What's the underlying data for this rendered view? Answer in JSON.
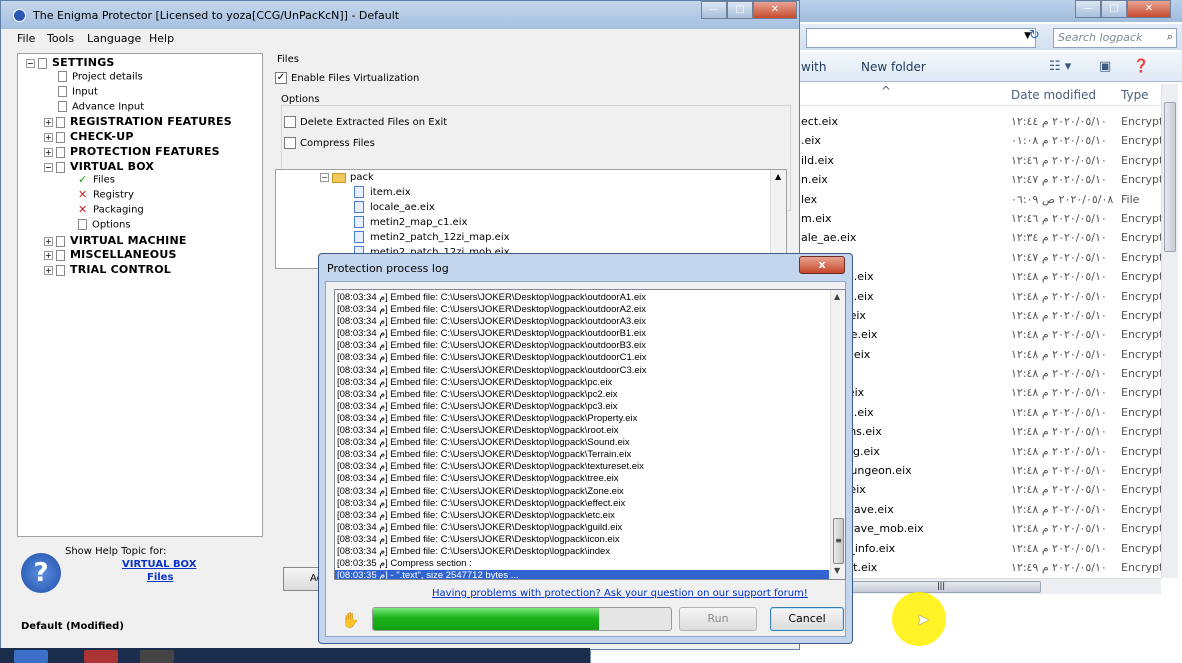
{
  "explorer": {
    "search_placeholder": "Search logpack",
    "toolbar_partial": "with",
    "new_folder": "New folder",
    "header_name_arrow": "^",
    "header_date": "Date modified",
    "header_type": "Type",
    "rows": [
      {
        "name": "ect.eix",
        "date": "٢٠٢٠/٠٥/١٠ م ١٢:٤٤",
        "type": "Encrypt"
      },
      {
        "name": ".eix",
        "date": "٢٠٢٠/٠٥/١٠ م ٠١:٠٨",
        "type": "Encrypt"
      },
      {
        "name": "ild.eix",
        "date": "٢٠٢٠/٠٥/١٠ م ١٢:٤٦",
        "type": "Encrypt"
      },
      {
        "name": "n.eix",
        "date": "٢٠٢٠/٠٥/١٠ م ١٢:٤٧",
        "type": "Encrypt"
      },
      {
        "name": "lex",
        "date": "٢٠٢٠/٠٥/٠٨ ص ٠٦:٠٩",
        "type": "File"
      },
      {
        "name": "m.eix",
        "date": "٢٠٢٠/٠٥/١٠ م ١٢:٤٦",
        "type": "Encrypt"
      },
      {
        "name": "ale_ae.eix",
        "date": "٢٠٢٠/٠٥/١٠ م ١٢:٣٤",
        "type": "Encrypt"
      },
      {
        "name": "c1.eix",
        "date": "٢٠٢٠/٠٥/١٠ م ١٢:٤٧",
        "type": "Encrypt"
      },
      {
        "name": "12zi_map.eix",
        "date": "٢٠٢٠/٠٥/١٠ م ١٢:٤٨",
        "type": "Encrypt"
      },
      {
        "name": "12zi_mob.eix",
        "date": "٢٠٢٠/٠٥/١٠ م ١٢:٤٨",
        "type": "Encrypt"
      },
      {
        "name": "12zi_obj.eix",
        "date": "٢٠٢٠/٠٥/١٠ م ١٢:٤٨",
        "type": "Encrypt"
      },
      {
        "name": "aggregate.eix",
        "date": "٢٠٢٠/٠٥/١٠ م ١٢:٤٨",
        "type": "Encrypt"
      },
      {
        "name": "arch_box.eix",
        "date": "٢٠٢٠/٠٥/١٠ م ١٢:٤٨",
        "type": "Encrypt"
      },
      {
        "name": "arena.eix",
        "date": "٢٠٢٠/٠٥/١٠ م ١٢:٤٨",
        "type": "Encrypt"
      },
      {
        "name": "balance.eix",
        "date": "٢٠٢٠/٠٥/١٠ م ١٢:٤٨",
        "type": "Encrypt"
      },
      {
        "name": "battlefied.eix",
        "date": "٢٠٢٠/٠٥/١٠ م ١٢:٤٨",
        "type": "Encrypt"
      },
      {
        "name": "beta_items.eix",
        "date": "٢٠٢٠/٠٥/١٠ م ١٢:٤٨",
        "type": "Encrypt"
      },
      {
        "name": "catch_king.eix",
        "date": "٢٠٢٠/٠٥/١٠ م ١٢:٤٨",
        "type": "Encrypt"
      },
      {
        "name": "crystal_dungeon.eix",
        "date": "٢٠٢٠/٠٥/١٠ م ١٢:٤٨",
        "type": "Encrypt"
      },
      {
        "name": "damage.eix",
        "date": "٢٠٢٠/٠٥/١٠ م ١٢:٤٨",
        "type": "Encrypt"
      },
      {
        "name": "defensewave.eix",
        "date": "٢٠٢٠/٠٥/١٠ م ١٢:٤٨",
        "type": "Encrypt"
      },
      {
        "name": "defensewave_mob.eix",
        "date": "٢٠٢٠/٠٥/١٠ م ١٢:٤٨",
        "type": "Encrypt"
      },
      {
        "name": "dungeon_info.eix",
        "date": "٢٠٢٠/٠٥/١٠ م ١٢:٤٨",
        "type": "Encrypt"
      },
      {
        "name": "fish_event.eix",
        "date": "٢٠٢٠/٠٥/١٠ م ١٢:٤٩",
        "type": "Encrypt"
      }
    ]
  },
  "enigma": {
    "title": "The Enigma Protector [Licensed to yoza[CCG/UnPacKcN]] - Default",
    "menu": [
      "File",
      "Tools",
      "Language",
      "Help"
    ],
    "tree": {
      "settings": "SETTINGS",
      "project_details": "Project details",
      "input": "Input",
      "advance_input": "Advance Input",
      "registration": "REGISTRATION FEATURES",
      "checkup": "CHECK-UP",
      "protection": "PROTECTION FEATURES",
      "virtual_box": "VIRTUAL BOX",
      "files": "Files",
      "registry": "Registry",
      "packaging": "Packaging",
      "options": "Options",
      "virtual_machine": "VIRTUAL MACHINE",
      "miscellaneous": "MISCELLANEOUS",
      "trial_control": "TRIAL CONTROL"
    },
    "help": {
      "label": "Show Help Topic for:",
      "link1": "VIRTUAL BOX",
      "link2": "Files"
    },
    "status": "Default  (Modified)",
    "files_panel": {
      "heading": "Files",
      "enable_virtualization": "Enable Files Virtualization",
      "options_heading": "Options",
      "delete_extracted": "Delete Extracted Files on Exit",
      "compress_files": "Compress Files",
      "add_button": "Add"
    },
    "file_tree": {
      "folder": "pack",
      "files": [
        "item.eix",
        "locale_ae.eix",
        "metin2_map_c1.eix",
        "metin2_patch_12zi_map.eix",
        "metin2_patch_12zi_mob.eix"
      ]
    }
  },
  "dialog": {
    "title": "Protection process log",
    "close": "x",
    "log_lines": [
      "[08:03:34 م] Embed file: C:\\Users\\JOKER\\Desktop\\logpack\\outdoorA1.eix",
      "[08:03:34 م] Embed file: C:\\Users\\JOKER\\Desktop\\logpack\\outdoorA2.eix",
      "[08:03:34 م] Embed file: C:\\Users\\JOKER\\Desktop\\logpack\\outdoorA3.eix",
      "[08:03:34 م] Embed file: C:\\Users\\JOKER\\Desktop\\logpack\\outdoorB1.eix",
      "[08:03:34 م] Embed file: C:\\Users\\JOKER\\Desktop\\logpack\\outdoorB3.eix",
      "[08:03:34 م] Embed file: C:\\Users\\JOKER\\Desktop\\logpack\\outdoorC1.eix",
      "[08:03:34 م] Embed file: C:\\Users\\JOKER\\Desktop\\logpack\\outdoorC3.eix",
      "[08:03:34 م] Embed file: C:\\Users\\JOKER\\Desktop\\logpack\\pc.eix",
      "[08:03:34 م] Embed file: C:\\Users\\JOKER\\Desktop\\logpack\\pc2.eix",
      "[08:03:34 م] Embed file: C:\\Users\\JOKER\\Desktop\\logpack\\pc3.eix",
      "[08:03:34 م] Embed file: C:\\Users\\JOKER\\Desktop\\logpack\\Property.eix",
      "[08:03:34 م] Embed file: C:\\Users\\JOKER\\Desktop\\logpack\\root.eix",
      "[08:03:34 م] Embed file: C:\\Users\\JOKER\\Desktop\\logpack\\Sound.eix",
      "[08:03:34 م] Embed file: C:\\Users\\JOKER\\Desktop\\logpack\\Terrain.eix",
      "[08:03:34 م] Embed file: C:\\Users\\JOKER\\Desktop\\logpack\\textureset.eix",
      "[08:03:34 م] Embed file: C:\\Users\\JOKER\\Desktop\\logpack\\tree.eix",
      "[08:03:34 م] Embed file: C:\\Users\\JOKER\\Desktop\\logpack\\Zone.eix",
      "[08:03:34 م] Embed file: C:\\Users\\JOKER\\Desktop\\logpack\\effect.eix",
      "[08:03:34 م] Embed file: C:\\Users\\JOKER\\Desktop\\logpack\\etc.eix",
      "[08:03:34 م] Embed file: C:\\Users\\JOKER\\Desktop\\logpack\\guild.eix",
      "[08:03:34 م] Embed file: C:\\Users\\JOKER\\Desktop\\logpack\\icon.eix",
      "[08:03:34 م] Embed file: C:\\Users\\JOKER\\Desktop\\logpack\\index",
      "[08:03:35 م] Compress section :",
      "[08:03:35 م]  - \".text\", size 2547712 bytes ..."
    ],
    "support_link": "Having problems with protection? Ask your question on our support forum!",
    "progress_fraction": 0.76,
    "run_button": "Run",
    "cancel_button": "Cancel"
  },
  "colors": {
    "progress": "#1db41d",
    "selection": "#3164d0",
    "link": "#0033cc",
    "cursor_highlight": "#fff000"
  }
}
